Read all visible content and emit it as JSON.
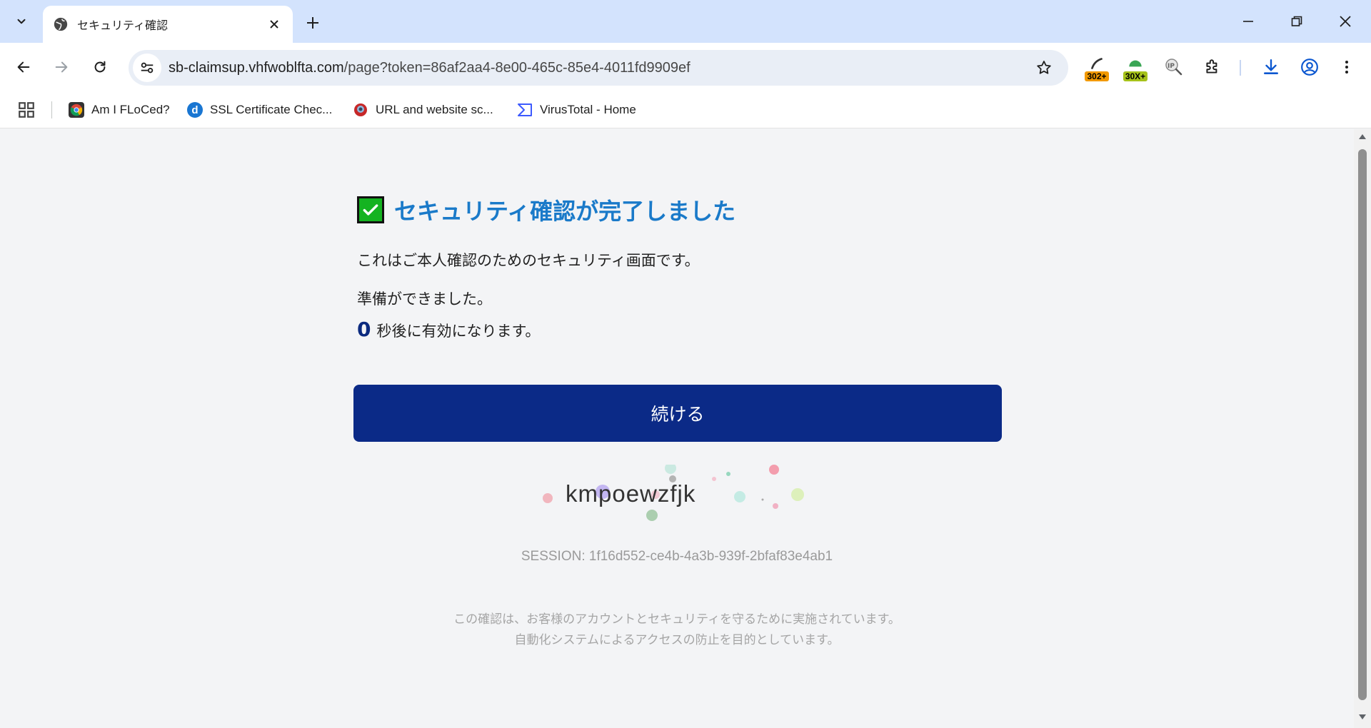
{
  "browser": {
    "tab": {
      "title": "セキュリティ確認"
    },
    "address": {
      "host": "sb-claimsup.vhfwoblfta.com",
      "path": "/page?token=86af2aa4-8e00-465c-85e4-4011fd9909ef"
    },
    "extensions": [
      {
        "icon": "redirect-302-icon",
        "badge": "302+",
        "badge_color": "#f29900"
      },
      {
        "icon": "redirect-30x-icon",
        "badge": "30X+",
        "badge_color": "#a6c21a"
      },
      {
        "icon": "ip-lookup-icon"
      },
      {
        "icon": "puzzle-extensions-icon"
      }
    ],
    "bookmarks": [
      {
        "label": "Am I FLoCed?",
        "icon": "chrome-icon"
      },
      {
        "label": "SSL Certificate Chec...",
        "icon": "d-icon"
      },
      {
        "label": "URL and website sc...",
        "icon": "urlscan-icon"
      },
      {
        "label": "VirusTotal - Home",
        "icon": "virustotal-icon"
      }
    ]
  },
  "page": {
    "title": "セキュリティ確認が完了しました",
    "description": "これはご本人確認のためのセキュリティ画面です。",
    "ready_text": "準備ができました。",
    "countdown_value": "0",
    "countdown_suffix": "秒後に有効になります。",
    "continue_label": "続ける",
    "captcha_text": "kmpoewzfjk",
    "session_text": "SESSION: 1f16d552-ce4b-4a3b-939f-2bfaf83e4ab1",
    "footer_line1": "この確認は、お客様のアカウントとセキュリティを守るために実施されています。",
    "footer_line2": "自動化システムによるアクセスの防止を目的としています。"
  },
  "colors": {
    "accent_title": "#1a7ac9",
    "button": "#0b2a87",
    "check": "#14b321"
  }
}
